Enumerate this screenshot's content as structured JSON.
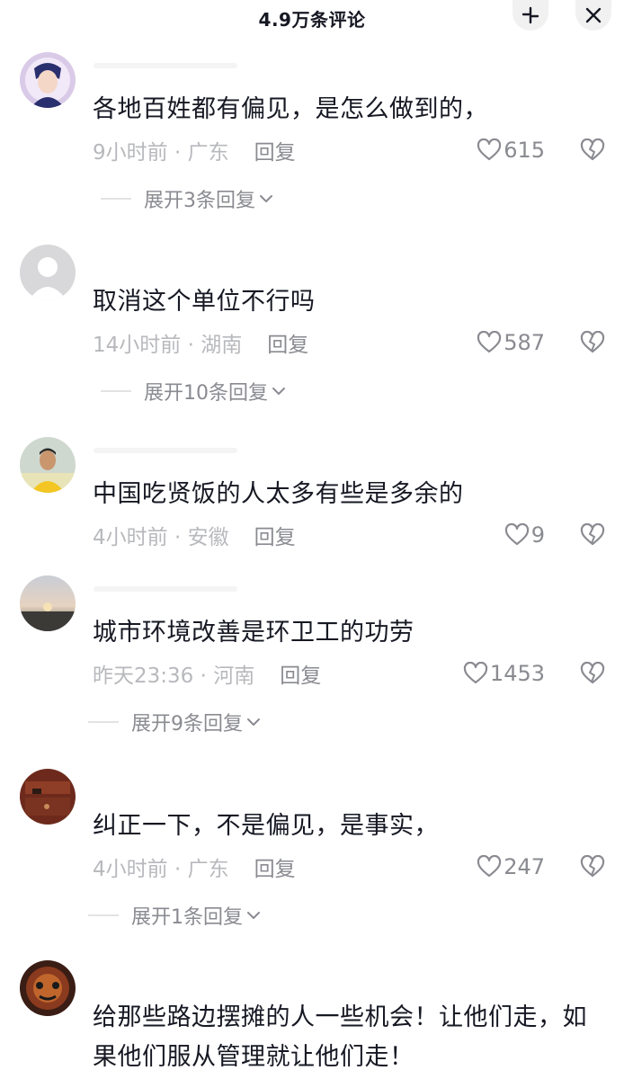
{
  "header": {
    "title": "4.9万条评论",
    "collapse_icon": "collapse-icon",
    "close_icon": "close-icon"
  },
  "comments": [
    {
      "text": "各地百姓都有偏见，是怎么做到的，",
      "meta": "9小时前 · 广东",
      "reply_label": "回复",
      "likes": "615",
      "expand": "展开3条回复"
    },
    {
      "text": "取消这个单位不行吗",
      "meta": "14小时前 · 湖南",
      "reply_label": "回复",
      "likes": "587",
      "expand": "展开10条回复"
    },
    {
      "text": "中国吃贤饭的人太多有些是多余的",
      "meta": "4小时前 · 安徽",
      "reply_label": "回复",
      "likes": "9",
      "expand": ""
    },
    {
      "text": "城市环境改善是环卫工的功劳",
      "meta": "昨天23:36 · 河南",
      "reply_label": "回复",
      "likes": "1453",
      "expand": "展开9条回复"
    },
    {
      "text": "纠正一下，不是偏见，是事实，",
      "meta": "4小时前 · 广东",
      "reply_label": "回复",
      "likes": "247",
      "expand": "展开1条回复"
    },
    {
      "text": "给那些路边摆摊的人一些机会！让他们走，如果他们服从管理就让他们走！",
      "meta": "",
      "reply_label": "",
      "likes": "",
      "expand": ""
    }
  ],
  "colors": {
    "text_primary": "#161823",
    "text_secondary": "#8a8b91",
    "text_meta": "#b8b9bd",
    "button_bg": "#f1f1f2"
  },
  "icons": {
    "like": "heart-outline-icon",
    "dislike": "broken-heart-icon",
    "expand": "chevron-down-icon"
  }
}
